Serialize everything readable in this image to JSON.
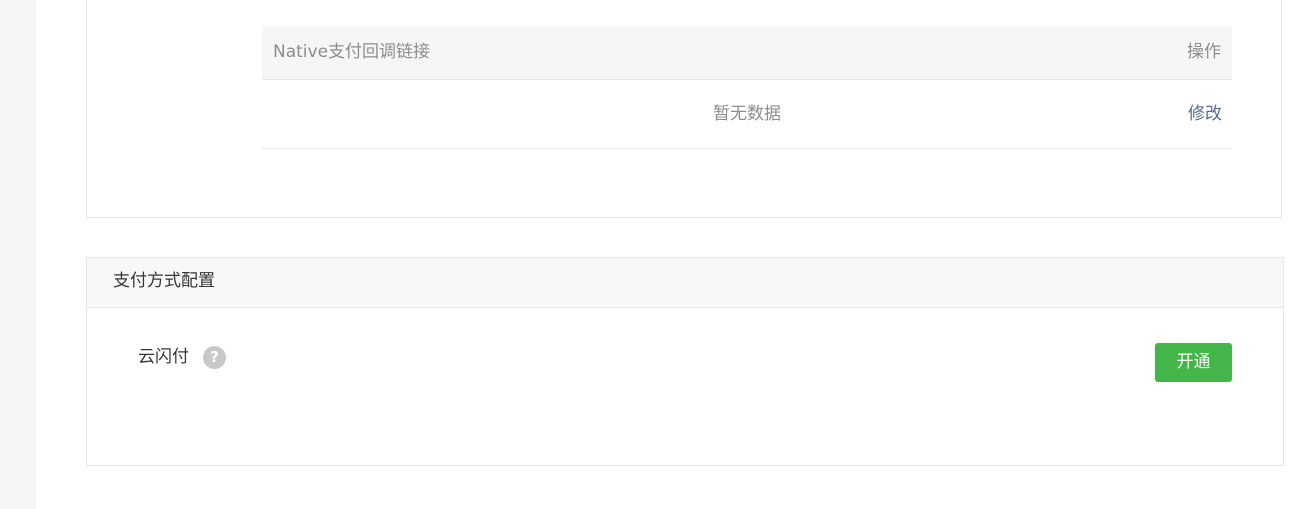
{
  "callback_table": {
    "header_link": "Native支付回调链接",
    "header_action": "操作",
    "empty_text": "暂无数据",
    "modify_label": "修改"
  },
  "payment_config": {
    "title": "支付方式配置",
    "method_label": "云闪付",
    "help_glyph": "?",
    "help_icon": "question-circle",
    "open_button_label": "开通"
  },
  "colors": {
    "primary_green": "#44b549",
    "link_blue": "#576b95",
    "muted_text": "#8d8d8d",
    "border": "#e7e7eb"
  }
}
